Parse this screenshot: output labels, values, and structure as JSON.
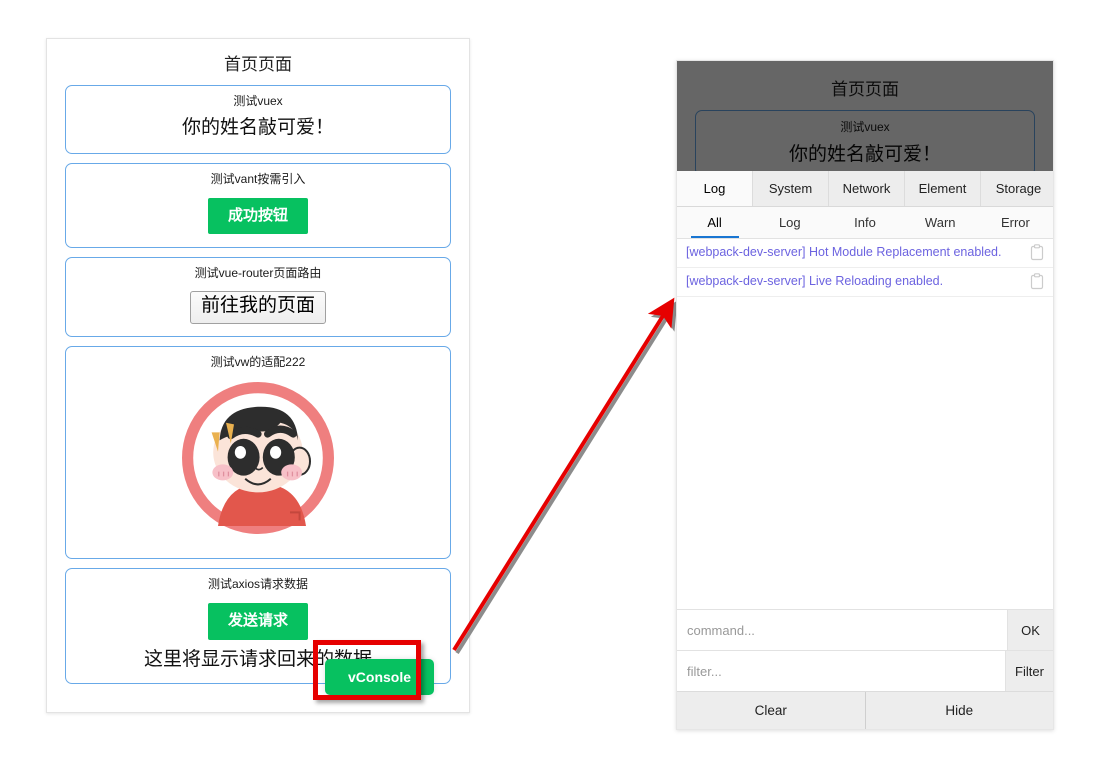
{
  "mobile_page": {
    "title": "首页页面",
    "cards": [
      {
        "label": "测试vuex",
        "value": "你的姓名敲可爱！",
        "kind": "text"
      },
      {
        "label": "测试vant按需引入",
        "button": "成功按钮",
        "kind": "vant-button"
      },
      {
        "label": "测试vue-router页面路由",
        "button": "前往我的页面",
        "kind": "native-button"
      },
      {
        "label": "测试vw的适配222",
        "kind": "image",
        "image_alt": "蜡笔小新头像"
      },
      {
        "label": "测试axios请求数据",
        "button": "发送请求",
        "value": "这里将显示请求回来的数据",
        "kind": "request"
      }
    ],
    "vconsole_switch": "vConsole"
  },
  "vconsole": {
    "masked_page": {
      "title": "首页页面",
      "card_label": "测试vuex",
      "card_value": "你的姓名敲可爱！"
    },
    "tabs": [
      {
        "label": "Log",
        "active": true
      },
      {
        "label": "System",
        "active": false
      },
      {
        "label": "Network",
        "active": false
      },
      {
        "label": "Element",
        "active": false
      },
      {
        "label": "Storage",
        "active": false
      }
    ],
    "log_levels": [
      {
        "label": "All",
        "active": true
      },
      {
        "label": "Log",
        "active": false
      },
      {
        "label": "Info",
        "active": false
      },
      {
        "label": "Warn",
        "active": false
      },
      {
        "label": "Error",
        "active": false
      }
    ],
    "log_rows": [
      {
        "text": "[webpack-dev-server] Hot Module Replacement enabled.",
        "icon": "clipboard-icon"
      },
      {
        "text": "[webpack-dev-server] Live Reloading enabled.",
        "icon": "clipboard-icon"
      }
    ],
    "command_placeholder": "command...",
    "command_button": "OK",
    "filter_placeholder": "filter...",
    "filter_button": "Filter",
    "bottom_buttons": [
      "Clear",
      "Hide"
    ]
  },
  "annotation": {
    "highlight_color": "#e60000",
    "arrow_color": "#e60000"
  },
  "colors": {
    "vant_green": "#07c160",
    "card_border_blue": "#68a9e8",
    "log_text": "#6c63e0",
    "tab_underline": "#1976d2"
  }
}
